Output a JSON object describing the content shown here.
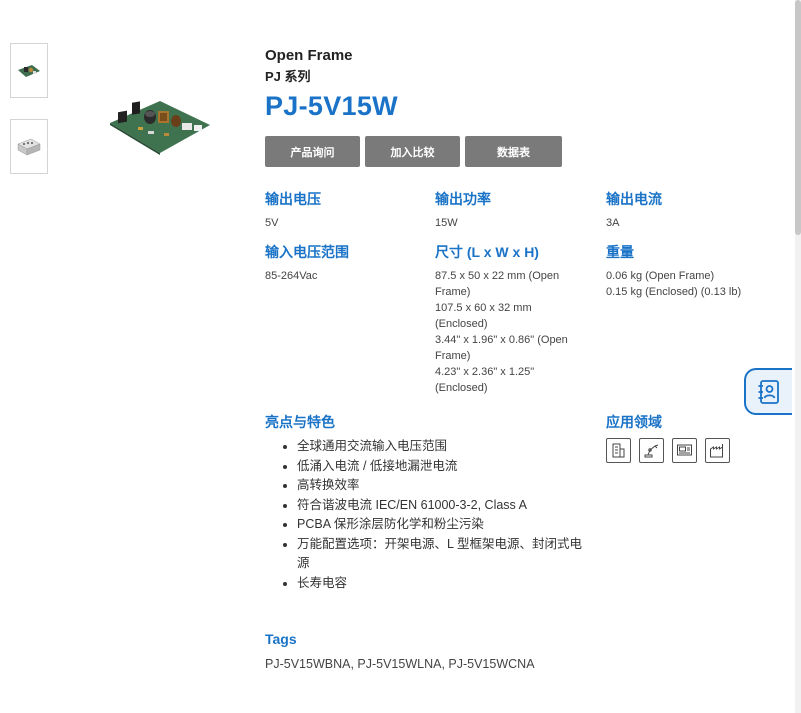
{
  "product": {
    "category": "Open Frame",
    "series": "PJ 系列",
    "model": "PJ-5V15W"
  },
  "buttons": {
    "inquiry": "产品询问",
    "compare": "加入比较",
    "datasheet": "数据表"
  },
  "specs": {
    "output_voltage": {
      "label": "输出电压",
      "value": "5V"
    },
    "output_power": {
      "label": "输出功率",
      "value": "15W"
    },
    "output_current": {
      "label": "输出电流",
      "value": "3A"
    },
    "input_range": {
      "label": "输入电压范围",
      "value": "85-264Vac"
    },
    "dimensions": {
      "label": "尺寸 (L x W x H)",
      "lines": [
        "87.5 x 50 x 22 mm (Open Frame)",
        "107.5 x 60 x 32 mm (Enclosed)",
        "3.44\" x 1.96\" x 0.86\" (Open Frame)",
        "4.23\" x 2.36\" x 1.25\" (Enclosed)"
      ]
    },
    "weight": {
      "label": "重量",
      "lines": [
        "0.06 kg (Open Frame)",
        "0.15 kg (Enclosed) (0.13 lb)"
      ]
    }
  },
  "highlights": {
    "title": "亮点与特色",
    "items": [
      "全球通用交流输入电压范围",
      "低涌入电流 / 低接地漏泄电流",
      "高转换效率",
      "符合谐波电流 IEC/EN 61000-3-2, Class A",
      "PCBA 保形涂层防化学和粉尘污染",
      "万能配置选项：开架电源、L 型框架电源、封闭式电源",
      "长寿电容"
    ]
  },
  "applications": {
    "title": "应用领域",
    "icons": [
      "building-icon",
      "robot-arm-icon",
      "monitor-device-icon",
      "factory-icon"
    ]
  },
  "tags": {
    "title": "Tags",
    "value": "PJ-5V15WBNA, PJ-5V15WLNA, PJ-5V15WCNA"
  },
  "colors": {
    "accent": "#1a73c7",
    "button_bg": "#7a7a7a"
  }
}
